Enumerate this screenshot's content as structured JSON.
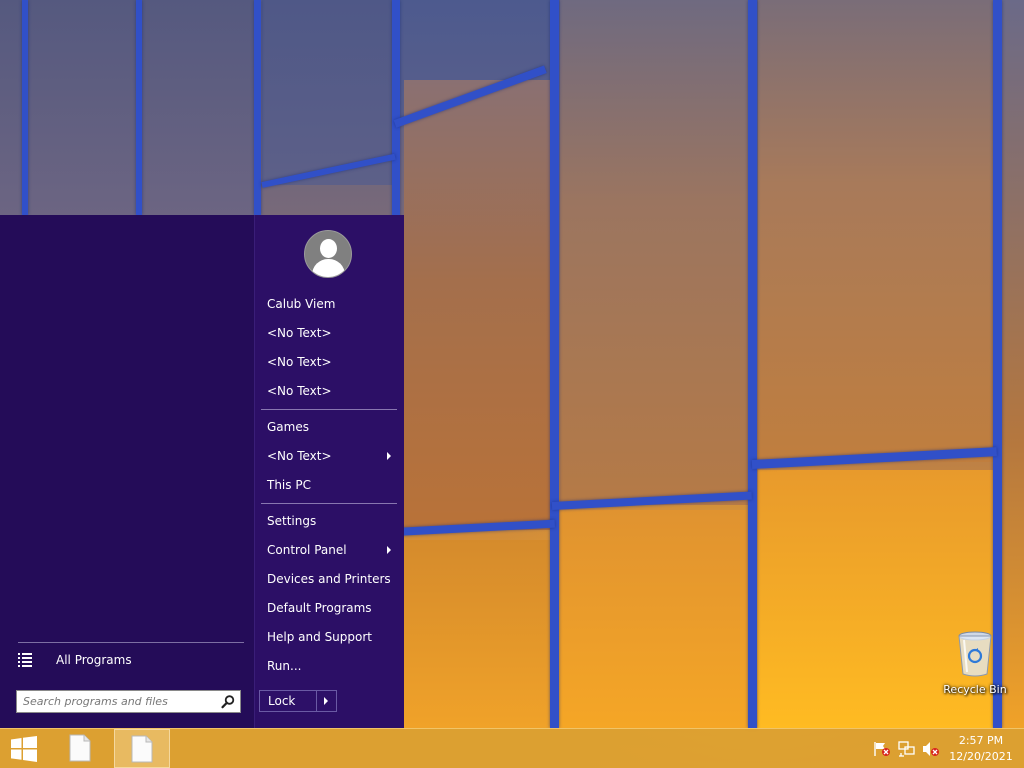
{
  "start_menu": {
    "all_programs_label": "All Programs",
    "search_placeholder": "Search programs and files",
    "user_name": "Calub Viem",
    "items": [
      {
        "label": "<No Text>"
      },
      {
        "label": "<No Text>"
      },
      {
        "label": "<No Text>"
      },
      {
        "label": "Games"
      },
      {
        "label": "<No Text>",
        "has_submenu": true
      },
      {
        "label": "This PC"
      },
      {
        "label": "Settings"
      },
      {
        "label": "Control Panel",
        "has_submenu": true
      },
      {
        "label": "Devices and Printers"
      },
      {
        "label": "Default Programs"
      },
      {
        "label": "Help and Support"
      },
      {
        "label": "Run..."
      }
    ],
    "lock_label": "Lock",
    "colors": {
      "background": "#240c58",
      "right_pane": "#2c0f66",
      "separator": "#8877b0"
    }
  },
  "desktop": {
    "icons": [
      {
        "label": "Recycle Bin",
        "icon": "recycle-bin-icon"
      }
    ]
  },
  "taskbar": {
    "start_icon": "windows-logo-icon",
    "apps": [
      {
        "icon": "document-icon",
        "active": false
      },
      {
        "icon": "document-icon",
        "active": true
      }
    ],
    "tray_icons": [
      "action-center-flag-icon",
      "network-icon",
      "volume-muted-icon"
    ],
    "clock": {
      "time": "2:57 PM",
      "date": "12/20/2021"
    },
    "color": "#daa032"
  }
}
